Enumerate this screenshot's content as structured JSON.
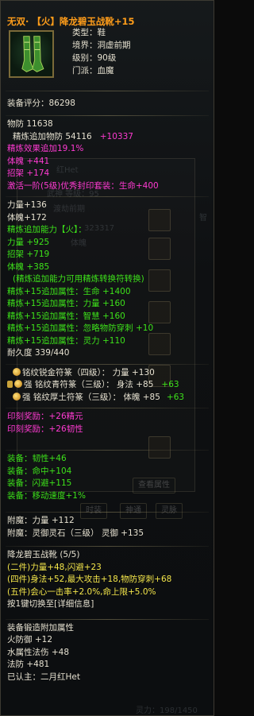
{
  "header": {
    "title": "无双· 【火】降龙碧玉战靴+15",
    "meta": [
      "类型：鞋",
      "境界：洞虚前期",
      "级别：90级",
      "门派：血魔"
    ]
  },
  "score": "装备评分：86298",
  "base": [
    {
      "text": "物防 11638",
      "color": "w"
    },
    {
      "text": "精炼追加物防 54116",
      "extra": "+10337",
      "color": "w",
      "extra_color": "m",
      "indent": true
    },
    {
      "text": "精炼效果追加19.1%",
      "color": "m"
    },
    {
      "text": "体魄 +441",
      "color": "m"
    },
    {
      "text": "招架 +174",
      "color": "m"
    },
    {
      "text": "激活一阶(5级)优秀封印套装：生命+400",
      "color": "m"
    }
  ],
  "refine": [
    {
      "text": "力量+136",
      "color": "w"
    },
    {
      "text": "体魄+172",
      "color": "w"
    },
    {
      "text": "精炼追加能力【火】：",
      "color": "g"
    },
    {
      "text": "力量 +925",
      "color": "g"
    },
    {
      "text": "招架 +719",
      "color": "g"
    },
    {
      "text": "体魄 +385",
      "color": "g"
    },
    {
      "text": "(精炼追加能力可用精炼转换符转换)",
      "color": "g",
      "indent": true
    },
    {
      "text": "精炼+15追加属性：生命 +1400",
      "color": "g"
    },
    {
      "text": "精炼+15追加属性：力量 +160",
      "color": "g"
    },
    {
      "text": "精炼+15追加属性：智慧 +160",
      "color": "g"
    },
    {
      "text": "精炼+15追加属性：忽略物防穿刺 +10",
      "color": "g"
    },
    {
      "text": "精炼+15追加属性：灵力 +110",
      "color": "g"
    },
    {
      "text": "耐久度 339/440",
      "color": "w"
    }
  ],
  "runes": [
    {
      "text": "铭纹锐金符篆（四级）：  力量 +130",
      "icon": "gem",
      "color": "w"
    },
    {
      "text": "强 铭纹青符篆（三级）：  身法 +85",
      "extra": "+63",
      "icon": "lock-gem",
      "color": "w"
    },
    {
      "text": "强 铭纹厚土符篆（三级）：  体魄 +85",
      "extra": "+63",
      "icon": "gem",
      "color": "w"
    }
  ],
  "seal": [
    "印刻奖励：+26精元",
    "印刻奖励：+26韧性"
  ],
  "equip_bonus": [
    "装备：韧性+46",
    "装备：命中+104",
    "装备：闪避+115",
    "装备：移动速度+1%"
  ],
  "attach": [
    "附魔：力量 +112",
    "附魔：灵御灵石（三级）  灵御 +135"
  ],
  "set": {
    "title": "降龙碧玉战靴 (5/5)",
    "lines": [
      "(二件)力量+48,闪避+23",
      "(四件)身法+52,最大攻击+18,物防穿刺+68",
      "(五件)会心一击率+2.0%,命上限+5.0%"
    ],
    "switch": "按1键切换至[详细信息]"
  },
  "forge": {
    "title": "装备锻造附加属性",
    "lines": [
      "火防御 +12",
      "水属性法伤 +48",
      "法防 +481",
      "已认主：二月红Het"
    ]
  },
  "ghost_texts": [
    "红Het",
    "武神 等级：95 ",
    "渡劫前期",
    "323317",
    "体魄",
    "智",
    "查看属性",
    "时装",
    "神通",
    "灵脉",
    "灵力：198/1450"
  ]
}
